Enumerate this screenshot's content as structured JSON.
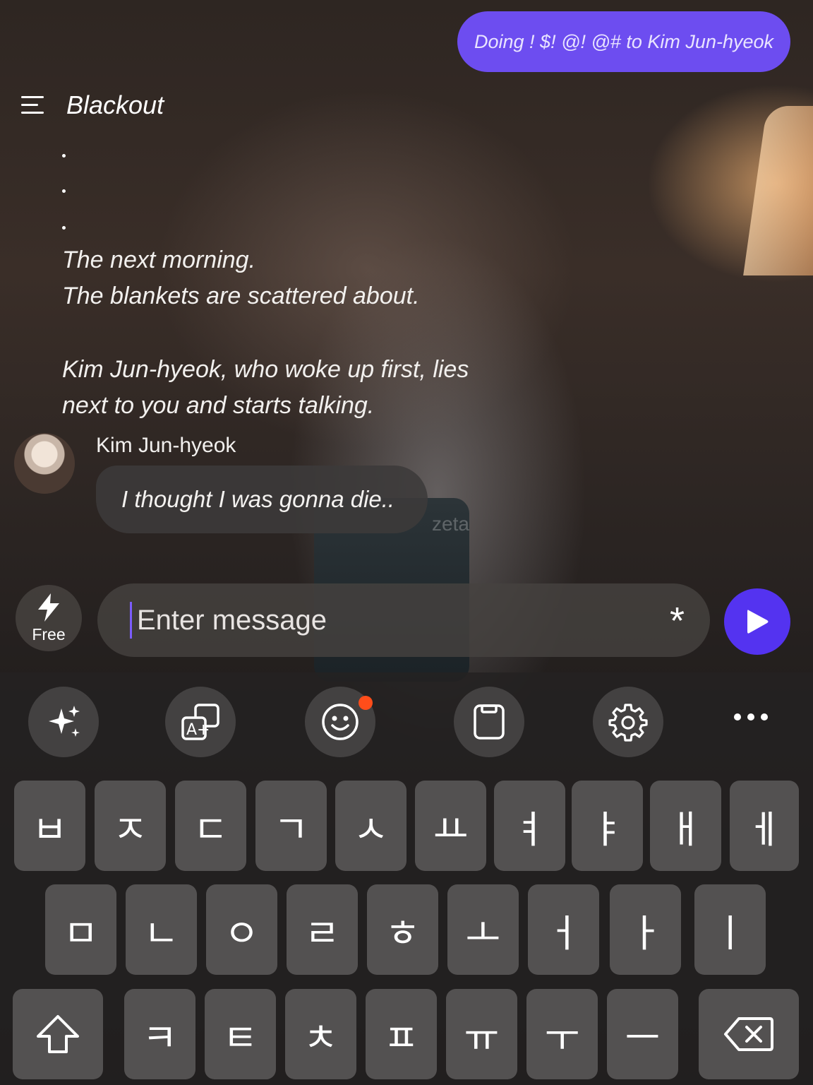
{
  "top_action": {
    "label": "Doing ! $! @! @# to Kim Jun-hyeok"
  },
  "header": {
    "title": "Blackout"
  },
  "narration": {
    "dots": [
      ".",
      ".",
      "."
    ],
    "line1": "The next morning.",
    "line2": "The blankets are scattered about.",
    "line3": "Kim Jun-hyeok, who woke up first, lies",
    "line4": "next to you and starts talking."
  },
  "message": {
    "speaker": "Kim Jun-hyeok",
    "text": "I thought I was gonna die.."
  },
  "watermark": "zeta",
  "composer": {
    "free_label": "Free",
    "placeholder": "Enter message",
    "asterisk": "*"
  },
  "toolbar_icons": [
    "sparkle-icon",
    "translate-icon",
    "emoji-icon",
    "clipboard-icon",
    "gear-icon",
    "more-icon"
  ],
  "keyboard": {
    "row1": [
      "ㅂ",
      "ㅈ",
      "ㄷ",
      "ㄱ",
      "ㅅ",
      "ㅛ",
      "ㅕ",
      "ㅑ",
      "ㅐ",
      "ㅔ"
    ],
    "row2": [
      "ㅁ",
      "ㄴ",
      "ㅇ",
      "ㄹ",
      "ㅎ",
      "ㅗ",
      "ㅓ",
      "ㅏ",
      "ㅣ"
    ],
    "row3": [
      "ㅋ",
      "ㅌ",
      "ㅊ",
      "ㅍ",
      "ㅠ",
      "ㅜ",
      "ㅡ"
    ]
  },
  "colors": {
    "accent": "#6d4df0",
    "send": "#5433f0",
    "notification": "#ff4d1a"
  }
}
